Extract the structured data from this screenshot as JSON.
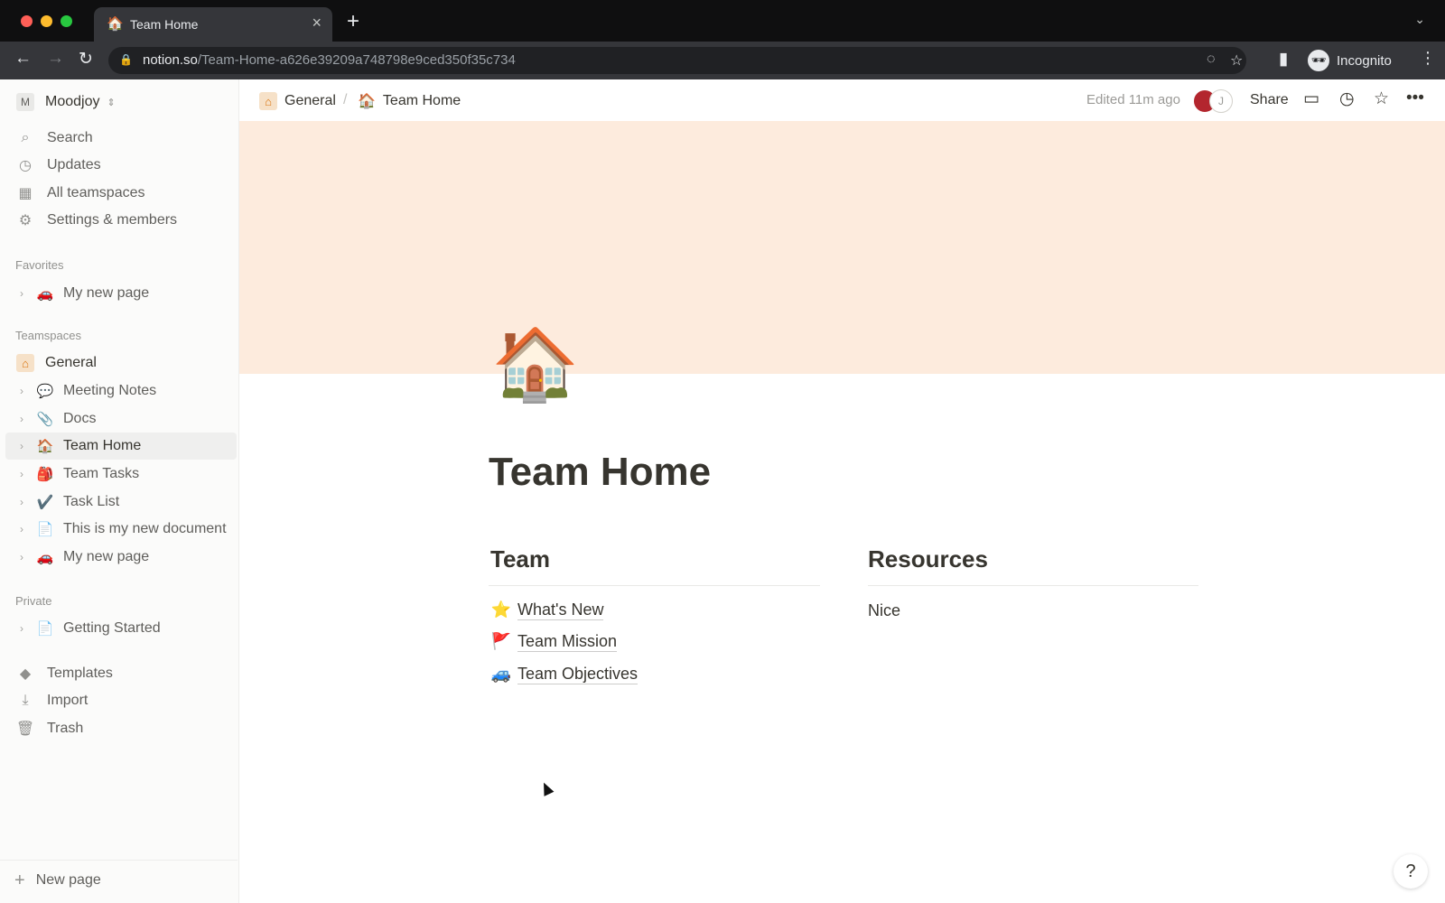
{
  "browser": {
    "tab_title": "Team Home",
    "tab_favicon": "🏠",
    "url_host": "notion.so",
    "url_path": "/Team-Home-a626e39209a748798e9ced350f35c734",
    "incognito_label": "Incognito"
  },
  "sidebar": {
    "workspace_initial": "M",
    "workspace_name": "Moodjoy",
    "top_items": [
      {
        "label": "Search",
        "icon": "search-icon"
      },
      {
        "label": "Updates",
        "icon": "clock-icon"
      },
      {
        "label": "All teamspaces",
        "icon": "building-icon"
      },
      {
        "label": "Settings & members",
        "icon": "gear-icon"
      }
    ],
    "favorites_heading": "Favorites",
    "favorites": [
      {
        "label": "My new page",
        "emoji": "🚗"
      }
    ],
    "teamspaces_heading": "Teamspaces",
    "teamspace_general": "General",
    "teamspace_pages": [
      {
        "label": "Meeting Notes",
        "emoji": "💬"
      },
      {
        "label": "Docs",
        "emoji": "📎"
      },
      {
        "label": "Team Home",
        "emoji": "🏠"
      },
      {
        "label": "Team Tasks",
        "emoji": "🎒"
      },
      {
        "label": "Task List",
        "emoji": "✔️"
      },
      {
        "label": "This is my new document",
        "emoji": "📄"
      },
      {
        "label": "My new page",
        "emoji": "🚗"
      }
    ],
    "private_heading": "Private",
    "private_pages": [
      {
        "label": "Getting Started",
        "emoji": "📄"
      }
    ],
    "bottom_items": [
      {
        "label": "Templates",
        "icon": "shapes-icon"
      },
      {
        "label": "Import",
        "icon": "download-icon"
      },
      {
        "label": "Trash",
        "icon": "trash-icon"
      }
    ],
    "new_page_label": "New page"
  },
  "topbar": {
    "breadcrumb": [
      {
        "label": "General",
        "emoji": "🏠"
      },
      {
        "label": "Team Home",
        "emoji": "🏠"
      }
    ],
    "edited": "Edited 11m ago",
    "avatar_second_initial": "J",
    "share_label": "Share"
  },
  "page": {
    "icon": "🏠",
    "title": "Team Home",
    "columns": [
      {
        "heading": "Team",
        "links": [
          {
            "emoji": "⭐",
            "label": "What's New"
          },
          {
            "emoji": "🚩",
            "label": "Team Mission"
          },
          {
            "emoji": "🚙",
            "label": "Team Objectives"
          }
        ]
      },
      {
        "heading": "Resources",
        "text": "Nice"
      }
    ]
  },
  "help_label": "?",
  "colors": {
    "cover": "#fdebdd",
    "sidebar_bg": "#fbfbfa",
    "text": "#37352f"
  }
}
